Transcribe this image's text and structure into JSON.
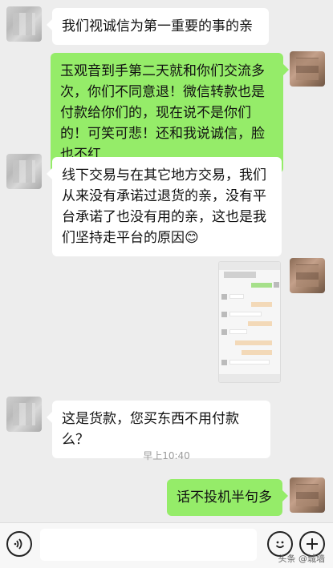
{
  "messages": [
    {
      "side": "left",
      "text": "我们视诚信为第一重要的事的亲"
    },
    {
      "side": "right",
      "text": "玉观音到手第二天就和你们交流多次，你们不同意退！微信转款也是付款给你们的，现在说不是你们的！可笑可悲！还和我说诚信，脸也不红"
    },
    {
      "side": "left",
      "text": "线下交易与在其它地方交易，我们从来没有承诺过退货的亲，没有平台承诺了也没有用的亲，这也是我们坚持走平台的原因😊"
    },
    {
      "side": "left",
      "text": "这是货款，您买东西不用付款么？"
    },
    {
      "side": "right",
      "text": "话不投机半句多"
    }
  ],
  "timestamp": "早上10:40",
  "input": {
    "value": "",
    "placeholder": ""
  },
  "watermark": "头条 @城墙",
  "colors": {
    "background": "#ededed",
    "sent_bubble": "#95ec69",
    "received_bubble": "#ffffff"
  },
  "icons": {
    "voice": "voice-icon",
    "emoji": "emoji-icon",
    "more": "plus-icon"
  }
}
